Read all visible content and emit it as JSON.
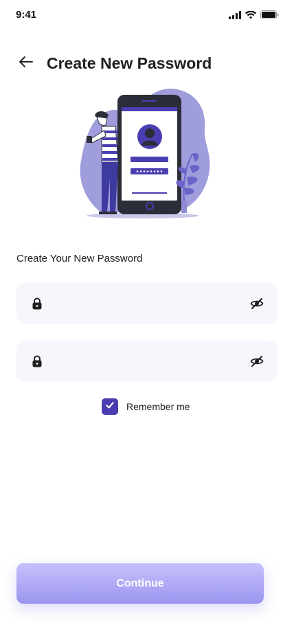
{
  "status_bar": {
    "time": "9:41"
  },
  "header": {
    "title": "Create New Password"
  },
  "form": {
    "section_label": "Create Your New Password",
    "password_field": {
      "value": ""
    },
    "confirm_field": {
      "value": ""
    },
    "remember_label": "Remember me",
    "remember_checked": true
  },
  "actions": {
    "continue_label": "Continue"
  },
  "colors": {
    "accent": "#4a3fb0",
    "field_bg": "#f6f6fd",
    "button_top": "#c6c2fb",
    "button_bottom": "#9b94f0"
  }
}
